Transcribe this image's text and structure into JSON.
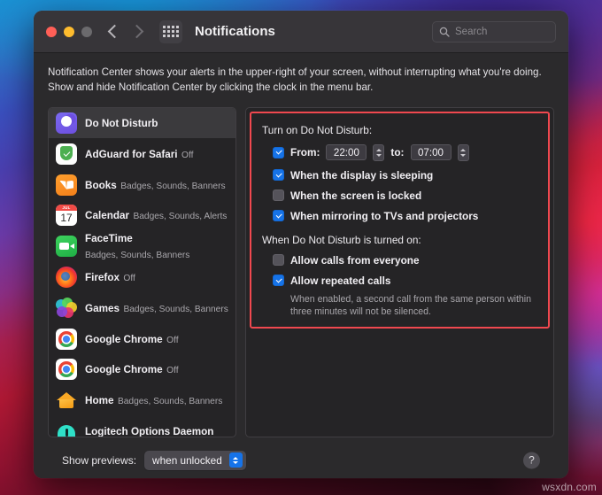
{
  "window": {
    "title": "Notifications",
    "search": {
      "placeholder": "Search",
      "value": ""
    },
    "description": "Notification Center shows your alerts in the upper-right of your screen, without interrupting what you're doing. Show and hide Notification Center by clicking the clock in the menu bar."
  },
  "sidebar": {
    "items": [
      {
        "name": "Do Not Disturb",
        "sub": "",
        "icon": "do-not-disturb-icon",
        "selected": true
      },
      {
        "name": "AdGuard for Safari",
        "sub": "Off",
        "icon": "adguard-icon",
        "selected": false
      },
      {
        "name": "Books",
        "sub": "Badges, Sounds, Banners",
        "icon": "books-icon",
        "selected": false
      },
      {
        "name": "Calendar",
        "sub": "Badges, Sounds, Alerts",
        "icon": "calendar-icon",
        "selected": false
      },
      {
        "name": "FaceTime",
        "sub": "Badges, Sounds, Banners",
        "icon": "facetime-icon",
        "selected": false
      },
      {
        "name": "Firefox",
        "sub": "Off",
        "icon": "firefox-icon",
        "selected": false
      },
      {
        "name": "Games",
        "sub": "Badges, Sounds, Banners",
        "icon": "games-icon",
        "selected": false
      },
      {
        "name": "Google Chrome",
        "sub": "Off",
        "icon": "chrome-icon",
        "selected": false
      },
      {
        "name": "Google Chrome",
        "sub": "Off",
        "icon": "chrome-icon",
        "selected": false
      },
      {
        "name": "Home",
        "sub": "Badges, Sounds, Banners",
        "icon": "home-icon",
        "selected": false
      },
      {
        "name": "Logitech Options Daemon",
        "sub": "",
        "icon": "logitech-icon",
        "selected": false
      }
    ],
    "calendar_icon": {
      "month": "JUL",
      "day": "17"
    }
  },
  "detail": {
    "highlight_color": "#f0484f",
    "turn_on_heading": "Turn on Do Not Disturb:",
    "schedule": {
      "checked": true,
      "from_label": "From:",
      "from_value": "22:00",
      "to_label": "to:",
      "to_value": "07:00"
    },
    "options": [
      {
        "label": "When the display is sleeping",
        "checked": true
      },
      {
        "label": "When the screen is locked",
        "checked": false
      },
      {
        "label": "When mirroring to TVs and projectors",
        "checked": true
      }
    ],
    "turned_on_heading": "When Do Not Disturb is turned on:",
    "call_options": [
      {
        "label": "Allow calls from everyone",
        "checked": false
      },
      {
        "label": "Allow repeated calls",
        "checked": true
      }
    ],
    "repeated_calls_note": "When enabled, a second call from the same person within three minutes will not be silenced."
  },
  "footer": {
    "previews_label": "Show previews:",
    "previews_value": "when unlocked",
    "help_label": "?"
  },
  "watermark": "wsxdn.com"
}
